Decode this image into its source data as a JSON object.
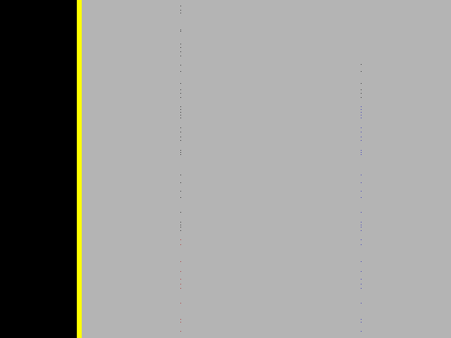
{
  "colors": {
    "left_panel": "#000000",
    "divider": "#ffff00",
    "canvas": "#b4b4b4",
    "dot_dark": "#2a2a2a",
    "dot_blue": "#3030c0",
    "dot_red": "#b03030"
  }
}
